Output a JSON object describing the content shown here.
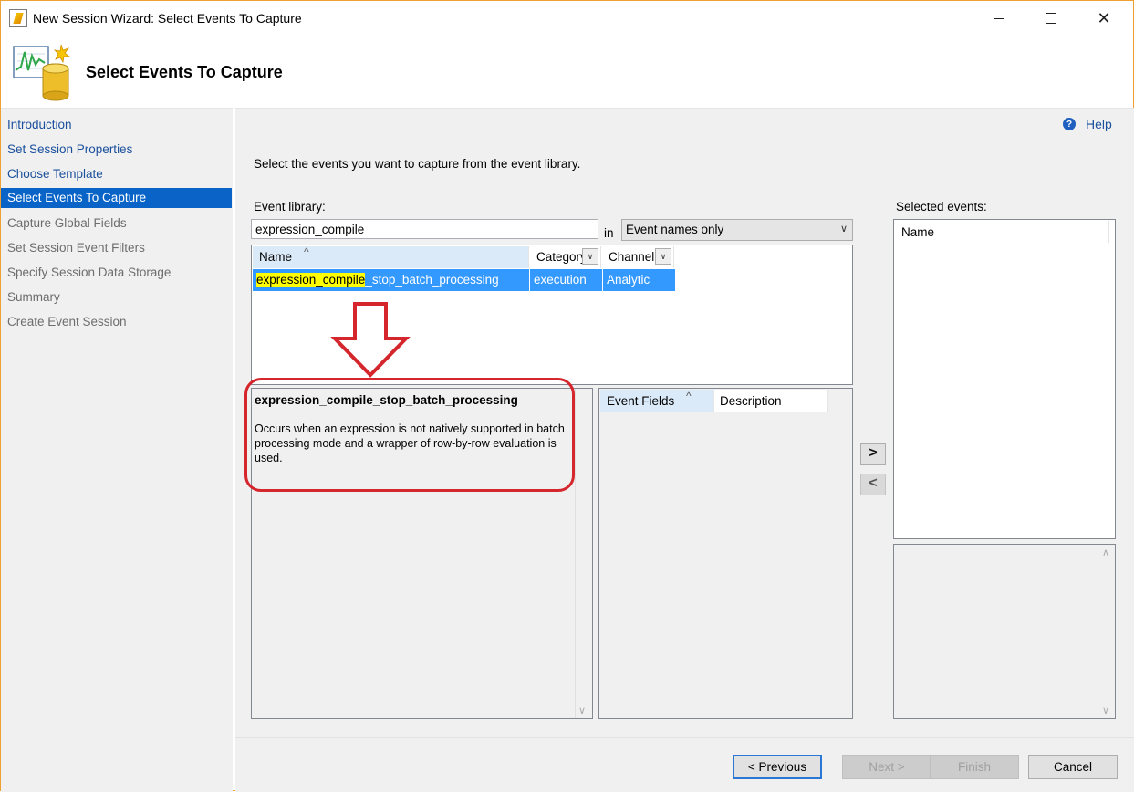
{
  "window": {
    "title": "New Session Wizard: Select Events To Capture",
    "close_glyph": "✕"
  },
  "header": {
    "title": "Select Events To Capture"
  },
  "nav": {
    "items": [
      {
        "label": "Introduction",
        "state": "link"
      },
      {
        "label": "Set Session Properties",
        "state": "link"
      },
      {
        "label": "Choose Template",
        "state": "link"
      },
      {
        "label": "Select Events To Capture",
        "state": "active"
      },
      {
        "label": "Capture Global Fields",
        "state": "disabled"
      },
      {
        "label": "Set Session Event Filters",
        "state": "disabled"
      },
      {
        "label": "Specify Session Data Storage",
        "state": "disabled"
      },
      {
        "label": "Summary",
        "state": "disabled"
      },
      {
        "label": "Create Event Session",
        "state": "disabled"
      }
    ]
  },
  "help": {
    "label": "Help",
    "icon": "?"
  },
  "main": {
    "instruction": "Select the events you want to capture from the event library.",
    "library_label": "Event library:",
    "selected_label": "Selected events:",
    "search_value": "expression_compile",
    "in_label": "in",
    "dropdown_value": "Event names only",
    "grid": {
      "columns": [
        "Name",
        "Category",
        "Channel"
      ],
      "rows": [
        {
          "name_highlight": "expression_compile",
          "name_rest": "_stop_batch_processing",
          "category": "execution",
          "channel": "Analytic"
        }
      ]
    },
    "description": {
      "title": "expression_compile_stop_batch_processing",
      "text": "Occurs when an expression is not natively supported in batch processing mode and a wrapper of row-by-row evaluation is used."
    },
    "fields_columns": [
      "Event Fields",
      "Description"
    ],
    "selected_columns": [
      "Name"
    ],
    "add_glyph": ">",
    "remove_glyph": "<"
  },
  "footer": {
    "previous": "< Previous",
    "next": "Next >",
    "finish": "Finish",
    "cancel": "Cancel"
  },
  "colors": {
    "accent": "#0a64c8",
    "selection": "#3399ff",
    "highlight": "#ffff00",
    "annotation": "#d4262c"
  }
}
